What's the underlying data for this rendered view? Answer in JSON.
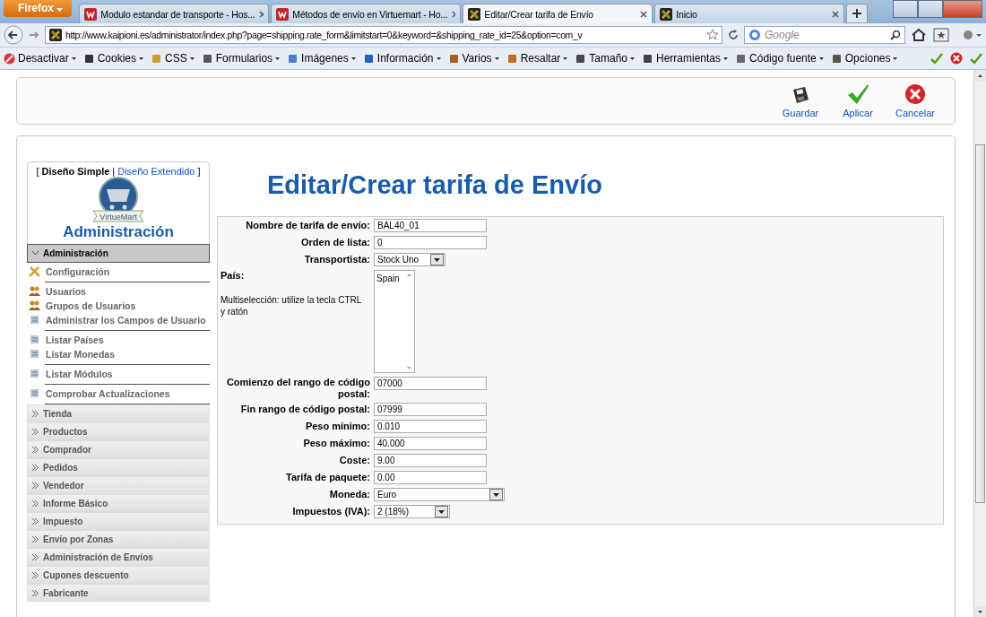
{
  "browser": {
    "menu_button": "Firefox",
    "tabs": [
      {
        "title": "Modulo estandar de transporte - Hos...",
        "selected": false
      },
      {
        "title": "Métodos de envío en Virtuemart - Ho...",
        "selected": false
      },
      {
        "title": "Editar/Crear tarifa de Envío",
        "selected": true
      },
      {
        "title": "Inicio",
        "selected": false
      }
    ],
    "url": "http://www.kaipioni.es/administrator/index.php?page=shipping.rate_form&limitstart=0&keyword=&shipping_rate_id=25&option=com_v",
    "search_placeholder": "Google",
    "toolbar": [
      "Desactivar",
      "Cookies",
      "CSS",
      "Formularios",
      "Imágenes",
      "Información",
      "Varios",
      "Resaltar",
      "Tamaño",
      "Herramientas",
      "Código fuente",
      "Opciones"
    ]
  },
  "actions": [
    {
      "label": "Guardar",
      "kind": "save"
    },
    {
      "label": "Aplicar",
      "kind": "apply"
    },
    {
      "label": "Cancelar",
      "kind": "cancel"
    }
  ],
  "sidebar": {
    "layout_prefix": "[",
    "layout_simple": "Diseño Simple",
    "layout_separator": "|",
    "layout_extended": "Diseño Extendido",
    "layout_suffix": "]",
    "logo_text": "VirtueMart",
    "title": "Administración",
    "sections": [
      {
        "label": "Administración",
        "expanded": true,
        "groups": [
          [
            {
              "label": "Configuración",
              "kind": "tools"
            }
          ],
          [
            {
              "label": "Usuarios",
              "kind": "users"
            },
            {
              "label": "Grupos de Usuarios",
              "kind": "users"
            },
            {
              "label": "Administrar los Campos de Usuario",
              "kind": "list"
            }
          ],
          [
            {
              "label": "Listar Países",
              "kind": "list"
            },
            {
              "label": "Listar Monedas",
              "kind": "list"
            }
          ],
          [
            {
              "label": "Listar Módulos",
              "kind": "list"
            }
          ],
          [
            {
              "label": "Comprobar Actualizaciones",
              "kind": "list"
            }
          ]
        ]
      },
      {
        "label": "Tienda",
        "expanded": false
      },
      {
        "label": "Productos",
        "expanded": false
      },
      {
        "label": "Comprador",
        "expanded": false
      },
      {
        "label": "Pedidos",
        "expanded": false
      },
      {
        "label": "Vendedor",
        "expanded": false
      },
      {
        "label": "Informe Básico",
        "expanded": false
      },
      {
        "label": "Impuesto",
        "expanded": false
      },
      {
        "label": "Envío por Zonas",
        "expanded": false
      },
      {
        "label": "Administración de Envíos",
        "expanded": false
      },
      {
        "label": "Cupones descuento",
        "expanded": false
      },
      {
        "label": "Fabricante",
        "expanded": false
      }
    ]
  },
  "form": {
    "heading": "Editar/Crear tarifa de Envío",
    "fields": [
      {
        "kind": "text",
        "label": "Nombre de tarifa de envío:",
        "value": "BAL40_01"
      },
      {
        "kind": "text",
        "label": "Orden de lista:",
        "value": "0"
      },
      {
        "kind": "select",
        "label": "Transportista:",
        "value": "Stock Uno"
      },
      {
        "kind": "multiselect",
        "label": "País:",
        "note": "Multiselección: utilize la tecla CTRL y ratón",
        "options": [
          "Spain"
        ]
      },
      {
        "kind": "text",
        "label": "Comienzo del rango de código postal:",
        "value": "07000"
      },
      {
        "kind": "text",
        "label": "Fin rango de código postal:",
        "value": "07999"
      },
      {
        "kind": "text",
        "label": "Peso mínimo:",
        "value": "0.010"
      },
      {
        "kind": "text",
        "label": "Peso máximo:",
        "value": "40.000"
      },
      {
        "kind": "text",
        "label": "Coste:",
        "value": "9.00"
      },
      {
        "kind": "text",
        "label": "Tarifa de paquete:",
        "value": "0.00"
      },
      {
        "kind": "select",
        "label": "Moneda:",
        "value": "Euro"
      },
      {
        "kind": "select",
        "label": "Impuestos (IVA):",
        "value": "2 (18%)"
      }
    ]
  }
}
